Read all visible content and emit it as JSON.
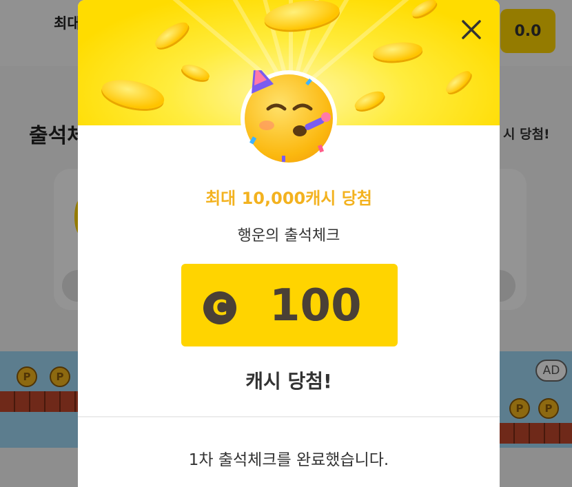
{
  "background": {
    "header_title": "최대",
    "balance": "0.0",
    "section_title": "출석체",
    "section_right": "시 당첨!",
    "ad_badge": "AD",
    "coin_letter": "P"
  },
  "modal": {
    "close_icon": "close-icon",
    "hero_emoji": "partying-face-emoji",
    "headline": "최대 10,000캐시 당첨",
    "title": "행운의 출석체크",
    "currency_symbol": "C",
    "reward_amount": "100",
    "result_text": "캐시 당첨!",
    "footer_message": "1차 출석체크를 완료했습니다."
  },
  "colors": {
    "accent_yellow": "#ffd400",
    "headline_orange": "#f3b21f",
    "amount_text": "#4a4036"
  }
}
